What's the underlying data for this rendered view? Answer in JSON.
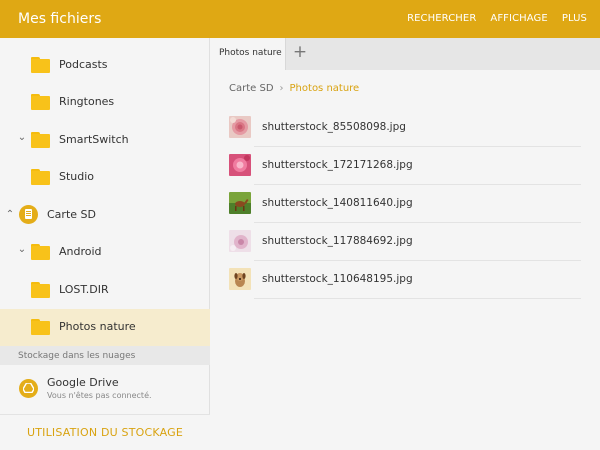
{
  "header": {
    "title": "Mes fichiers",
    "actions": [
      "RECHERCHER",
      "AFFICHAGE",
      "PLUS"
    ]
  },
  "sidebar": {
    "items": [
      {
        "label": "Podcasts",
        "icon": "folder-icon",
        "expander": ""
      },
      {
        "label": "Ringtones",
        "icon": "folder-icon",
        "expander": ""
      },
      {
        "label": "SmartSwitch",
        "icon": "folder-icon",
        "expander": "chevron-down"
      },
      {
        "label": "Studio",
        "icon": "folder-icon",
        "expander": ""
      },
      {
        "label": "Carte SD",
        "icon": "sd-card-icon",
        "expander": "chevron-up"
      },
      {
        "label": "Android",
        "icon": "folder-icon",
        "expander": "chevron-down"
      },
      {
        "label": "LOST.DIR",
        "icon": "folder-icon",
        "expander": ""
      },
      {
        "label": "Photos nature",
        "icon": "folder-icon",
        "expander": "",
        "selected": true
      }
    ],
    "cloud_header": "Stockage dans les nuages",
    "cloud_item": {
      "name": "Google Drive",
      "status": "Vous n'êtes pas connecté.",
      "icon": "google-drive-icon"
    },
    "storage_button": "UTILISATION DU STOCKAGE"
  },
  "main": {
    "tab_label": "Photos nature",
    "breadcrumb": {
      "root": "Carte SD",
      "current": "Photos nature"
    },
    "files": [
      {
        "name": "shutterstock_85508098.jpg",
        "thumb": "pink-rose"
      },
      {
        "name": "shutterstock_172171268.jpg",
        "thumb": "pink-flower"
      },
      {
        "name": "shutterstock_140811640.jpg",
        "thumb": "horse-field"
      },
      {
        "name": "shutterstock_117884692.jpg",
        "thumb": "pale-blossom"
      },
      {
        "name": "shutterstock_110648195.jpg",
        "thumb": "puppy"
      }
    ]
  },
  "colors": {
    "accent": "#dfa814",
    "selected_bg": "#f6ecce",
    "link": "#d9a311"
  }
}
